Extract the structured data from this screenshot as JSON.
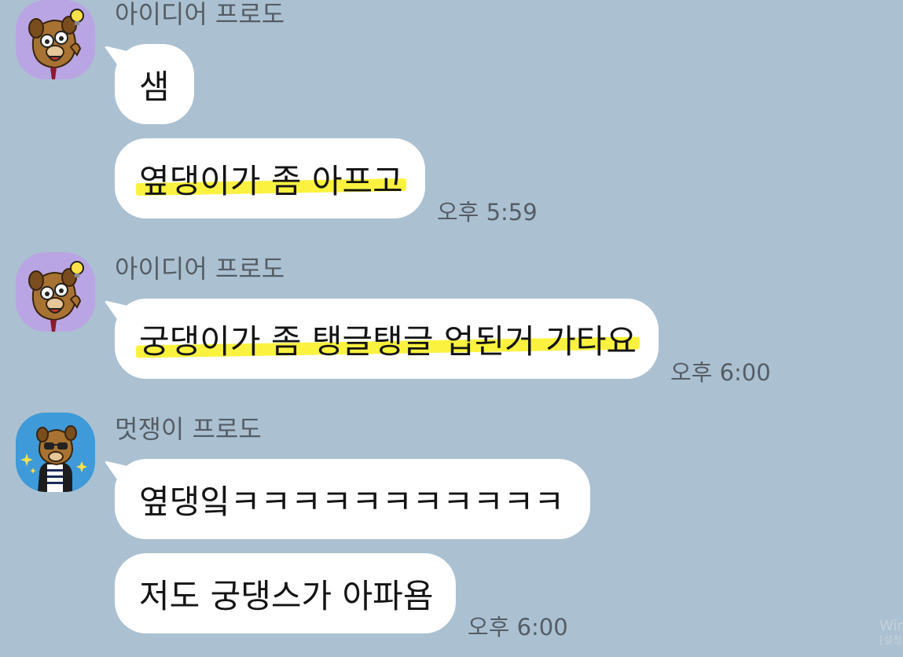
{
  "chat": {
    "messages": [
      {
        "sender": "아이디어 프로도",
        "avatar": "frodo-lightbulb-avatar",
        "bubbles": [
          "샘",
          "옆댕이가 좀 아프고"
        ],
        "time": "오후 5:59"
      },
      {
        "sender": "아이디어 프로도",
        "avatar": "frodo-lightbulb-avatar",
        "bubbles": [
          "궁댕이가 좀 탱글탱글 업된거 가타요"
        ],
        "time": "오후 6:00"
      },
      {
        "sender": "멋쟁이 프로도",
        "avatar": "frodo-sunglasses-avatar",
        "bubbles": [
          "옆댕잌ㅋㅋㅋㅋㅋㅋㅋㅋㅋㅋㅋ",
          "저도 궁댕스가 아파욤"
        ],
        "time": "오후 6:00"
      }
    ]
  },
  "watermark": {
    "line1": "Win",
    "line2": "[설정"
  },
  "colors": {
    "background": "#abc1d1",
    "bubble": "#ffffff",
    "highlight": "#faf01e",
    "avatar_purple": "#b9a5e3",
    "avatar_blue": "#3f9ad9"
  }
}
